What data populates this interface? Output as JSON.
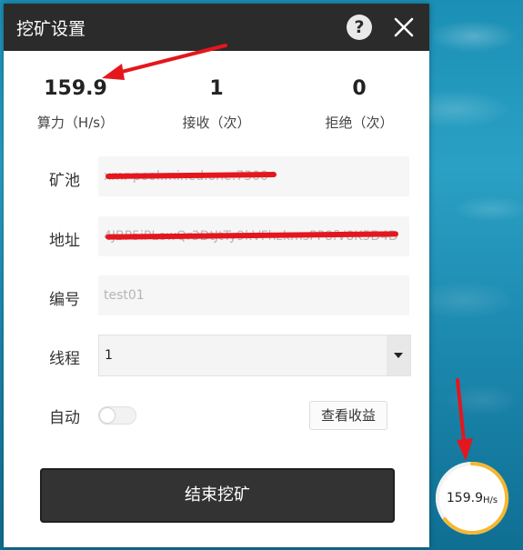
{
  "dialog": {
    "title": "挖矿设置",
    "help_icon": "question-circle-icon",
    "close_icon": "close-icon"
  },
  "stats": [
    {
      "value": "159.9",
      "label": "算力（H/s）"
    },
    {
      "value": "1",
      "label": "接收（次）"
    },
    {
      "value": "0",
      "label": "拒绝（次）"
    }
  ],
  "form": {
    "pool": {
      "label": "矿池",
      "value": "xmr-pool.mined.one:7300"
    },
    "address": {
      "label": "地址",
      "value": "4JBP5iPLewQr3DtJtTy9kVFhzkmsPP8fV8K5D4D"
    },
    "id": {
      "label": "编号",
      "value": "test01"
    },
    "threads": {
      "label": "线程",
      "value": "1"
    },
    "auto": {
      "label": "自动",
      "enabled": false
    }
  },
  "buttons": {
    "view_earnings": "查看收益",
    "stop_mining": "结束挖矿"
  },
  "floating_widget": {
    "value": "159.9",
    "unit": "H/s"
  },
  "colors": {
    "titlebar": "#2b2b2b",
    "button_dark": "#333333",
    "annotation_red": "#e5161d",
    "gauge_orange": "#f5b731"
  }
}
